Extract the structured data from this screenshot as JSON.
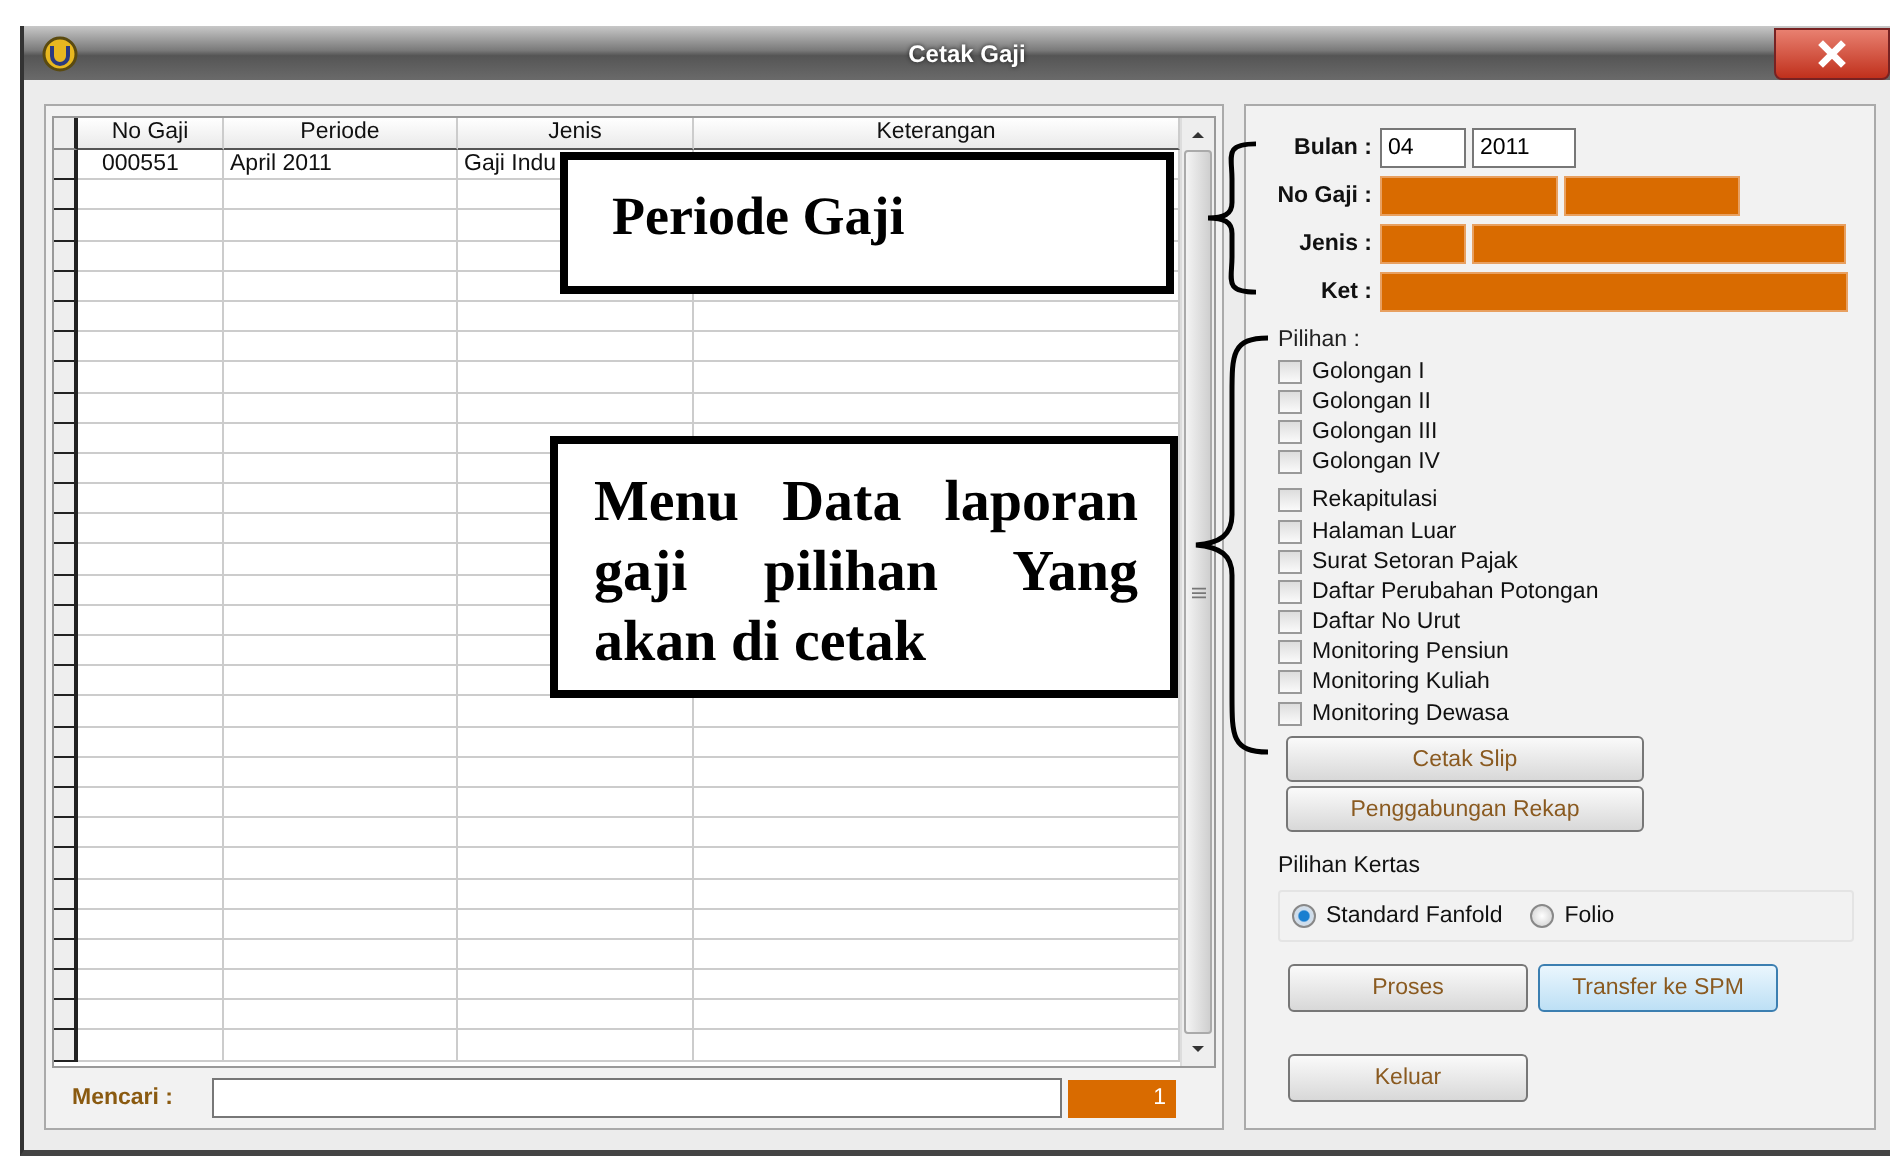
{
  "window": {
    "title": "Cetak Gaji"
  },
  "table": {
    "columns": [
      "No Gaji",
      "Periode",
      "Jenis",
      "Keterangan"
    ],
    "rows": [
      {
        "cells": [
          "000551",
          "April 2011",
          "Gaji Indu"
        ]
      }
    ]
  },
  "search": {
    "label": "Mencari :"
  },
  "record_count": "1",
  "form": {
    "fields": [
      {
        "label": "Bulan :",
        "inputs": [
          {
            "value": "04",
            "highlighted": false
          },
          {
            "value": "2011",
            "highlighted": false
          }
        ]
      },
      {
        "label": "No Gaji :",
        "inputs": [
          {
            "highlighted": true
          },
          {
            "highlighted": true
          }
        ]
      },
      {
        "label": "Jenis :",
        "inputs": [
          {
            "highlighted": true
          },
          {
            "highlighted": true
          }
        ]
      },
      {
        "label": "Ket :",
        "inputs": [
          {
            "highlighted": true
          }
        ]
      }
    ]
  },
  "options": {
    "label": "Pilihan :",
    "groups": [
      [
        {
          "label": "Golongan I",
          "checked": false
        },
        {
          "label": "Golongan II",
          "checked": false
        },
        {
          "label": "Golongan III",
          "checked": false
        },
        {
          "label": "Golongan IV",
          "checked": false
        }
      ],
      [
        {
          "label": "Rekapitulasi",
          "checked": false
        },
        {
          "label": "Halaman Luar",
          "checked": false
        },
        {
          "label": "Surat Setoran Pajak",
          "checked": false
        },
        {
          "label": "Daftar Perubahan Potongan",
          "checked": false
        },
        {
          "label": "Daftar No Urut",
          "checked": false
        },
        {
          "label": "Monitoring Pensiun",
          "checked": false
        },
        {
          "label": "Monitoring Kuliah",
          "checked": false
        },
        {
          "label": "Monitoring Dewasa",
          "checked": false
        }
      ]
    ]
  },
  "option_buttons": [
    "Cetak Slip",
    "Penggabungan Rekap"
  ],
  "paper": {
    "label": "Pilihan Kertas",
    "choices": [
      {
        "label": "Standard Fanfold",
        "selected": true
      },
      {
        "label": "Folio",
        "selected": false
      }
    ]
  },
  "action_buttons": [
    {
      "label": "Proses",
      "focused": false
    },
    {
      "label": "Transfer ke SPM",
      "focused": true
    }
  ],
  "exit_button": "Keluar",
  "annotations": [
    {
      "text": "Periode Gaji"
    },
    {
      "text": "Menu Data laporan gaji pilihan Yang akan di cetak"
    }
  ]
}
